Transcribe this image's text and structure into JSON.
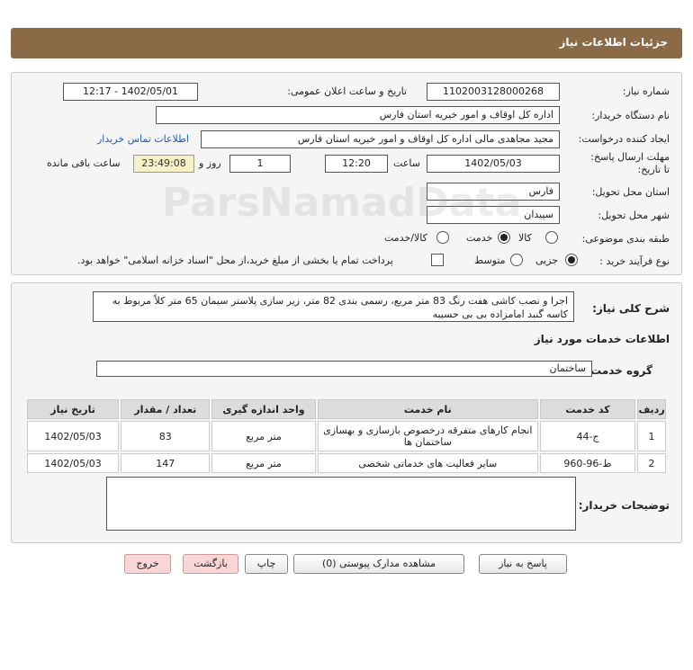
{
  "header": {
    "title": "جزئیات اطلاعات نیاز"
  },
  "form": {
    "need_number": {
      "label": "شماره نیاز:",
      "value": "1102003128000268"
    },
    "announce_datetime": {
      "label": "تاریخ و ساعت اعلان عمومی:",
      "value": "1402/05/01 - 12:17"
    },
    "buyer_org": {
      "label": "نام دستگاه خریدار:",
      "value": "اداره کل اوقاف و امور خیریه استان فارس"
    },
    "requester": {
      "label": "ایجاد کننده درخواست:",
      "value": "مجید مجاهدی مالی اداره کل اوقاف و امور خیریه استان فارس",
      "contact_link": "اطلاعات تماس خریدار"
    },
    "deadline": {
      "label": "مهلت ارسال پاسخ: تا تاریخ:",
      "date": "1402/05/03",
      "time_label": "ساعت",
      "time": "12:20",
      "days": "1",
      "days_label": "روز و",
      "remaining_time": "23:49:08",
      "remaining_label": "ساعت باقی مانده"
    },
    "province": {
      "label": "استان محل تحویل:",
      "value": "فارس"
    },
    "city": {
      "label": "شهر محل تحویل:",
      "value": "سپیدان"
    },
    "category": {
      "label": "طبقه بندی موضوعی:",
      "options": [
        "کالا",
        "خدمت",
        "کالا/خدمت"
      ],
      "selected": "خدمت"
    },
    "purchase_type": {
      "label": "نوع فرآیند خرید :",
      "options": [
        "جزیی",
        "متوسط"
      ],
      "selected": "جزیی",
      "checkbox_text": "پرداخت تمام یا بخشی از مبلغ خرید،از محل \"اسناد خزانه اسلامی\" خواهد بود."
    }
  },
  "description": {
    "label": "شرح کلی نیاز:",
    "text": "اجرا و نصب کاشی هفت رنگ  83 متر مربع، رسمی بندی  82 متر، زیر سازی پلاستر   سیمان 65 متر کلاً مربوط به کاسه گنبد امامزاده بی بی حسیبه"
  },
  "services": {
    "title": "اطلاعات خدمات مورد نیاز",
    "group_label": "گروه خدمت:",
    "group_value": "ساختمان",
    "columns": [
      "ردیف",
      "کد خدمت",
      "نام خدمت",
      "واحد اندازه گیری",
      "تعداد / مقدار",
      "تاریخ نیاز"
    ],
    "rows": [
      {
        "row": "1",
        "code": "ج-44",
        "name": "انجام کارهای متفرقه درخصوص بازسازی و بهسازی ساختمان ها",
        "unit": "متر مربع",
        "qty": "83",
        "date": "1402/05/03"
      },
      {
        "row": "2",
        "code": "ط-96-960",
        "name": "سایر فعالیت های خدماتی شخصی",
        "unit": "متر مربع",
        "qty": "147",
        "date": "1402/05/03"
      }
    ]
  },
  "buyer_notes": {
    "label": "توضیحات خریدار:",
    "value": ""
  },
  "buttons": {
    "reply": "پاسخ به نیاز",
    "attachments": "مشاهده مدارک پیوستی (0)",
    "print": "چاپ",
    "back": "بازگشت",
    "exit": "خروج"
  }
}
